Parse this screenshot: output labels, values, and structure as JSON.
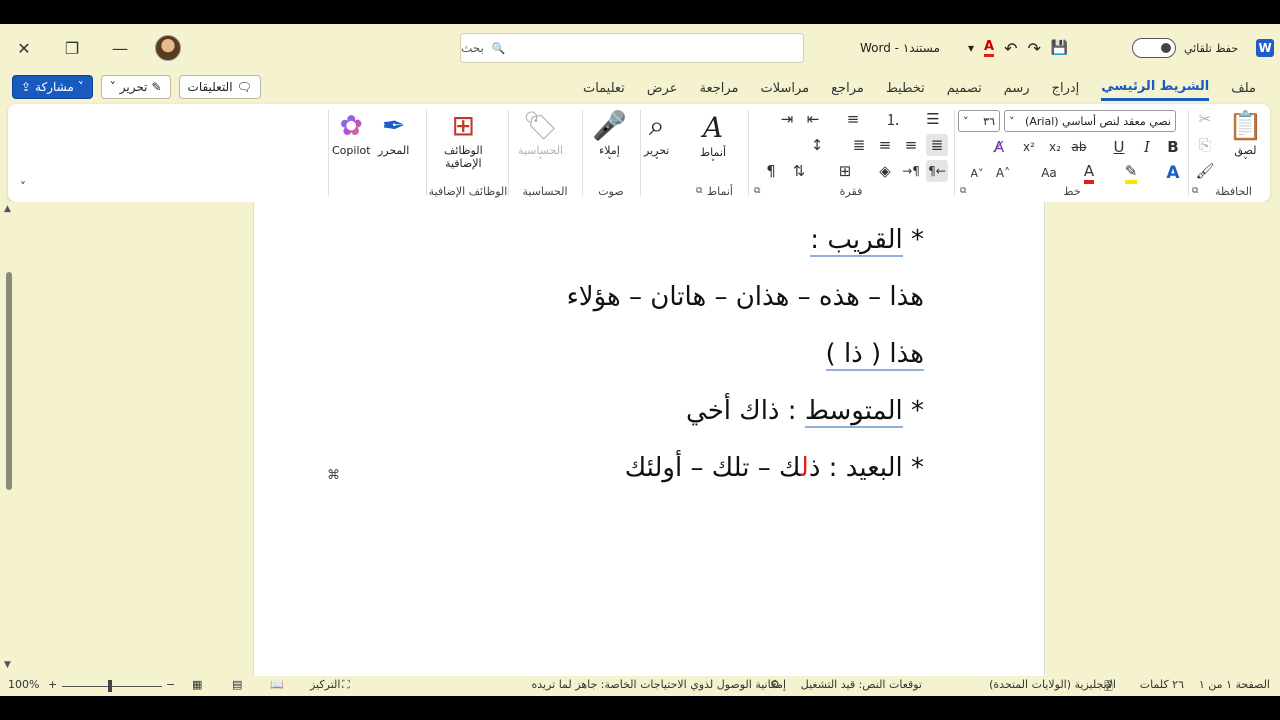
{
  "titlebar": {
    "app_logo": "W",
    "autosave_label": "حفظ تلقائي",
    "doc_title": "مستند١  -  Word",
    "search_placeholder": "بحث",
    "search_icon": "🔍",
    "close": "✕",
    "restore": "❐",
    "minimize": "—",
    "save_icon": "💾",
    "undo_icon": "↶",
    "redo_icon": "↷",
    "font_color_icon": "A",
    "customize_icon": "▾"
  },
  "tabs": {
    "items": [
      "ملف",
      "الشريط الرئيسي",
      "إدراج",
      "رسم",
      "تصميم",
      "تخطيط",
      "مراجع",
      "مراسلات",
      "مراجعة",
      "عرض",
      "تعليمات"
    ],
    "active_index": 1,
    "share_label": "مشاركة",
    "edit_label": "تحرير",
    "comments_label": "التعليقات"
  },
  "ribbon": {
    "clipboard": {
      "label": "الحافظة",
      "paste": "لصق"
    },
    "font": {
      "label": "خط",
      "font_name": "نصي معقد لنص أساسي (Arial)",
      "font_size": "٣٦",
      "bold": "B",
      "italic": "I",
      "underline": "U",
      "strike": "ab",
      "subscript": "x₂",
      "superscript": "x²",
      "grow": "A˄",
      "shrink": "A˅",
      "case": "Aa"
    },
    "paragraph": {
      "label": "فقرة"
    },
    "styles": {
      "label": "أنماط",
      "button": "أنماط"
    },
    "editing": {
      "button": "تحرير"
    },
    "voice": {
      "label": "صوت",
      "dictate": "إملاء"
    },
    "sensitivity": {
      "label": "الحساسية",
      "button": "الحساسية"
    },
    "addins": {
      "label": "الوظائف الإضافية",
      "button_line1": "الوظائف",
      "button_line2": "الإضافية"
    },
    "editor": {
      "button": "المحرر"
    },
    "copilot": {
      "button": "Copilot"
    }
  },
  "document": {
    "lines": [
      {
        "pre": "* ",
        "ul": "القريب :",
        "post": ""
      },
      {
        "pre": "هذا – هذه – هذان – هاتان – هؤلاء",
        "ul": "",
        "post": ""
      },
      {
        "pre": "",
        "ul": "هذا  ( ذا )",
        "post": ""
      },
      {
        "pre": "* ",
        "ul": "المتوسط",
        "post": " : ذاك أخي"
      }
    ],
    "line5": {
      "pre": "* البعيد : ذ",
      "red": "ل",
      "post": "ك – تلك – أولئك"
    }
  },
  "status": {
    "page": "الصفحة ١ من ١",
    "words": "٢٦ كلمات",
    "language": "الإنجليزية (الولايات المتحدة)",
    "predictions": "توقعات النص: قيد التشغيل",
    "accessibility": "إمكانية الوصول لذوي الاحتياجات الخاصة: جاهز لما تريده",
    "focus": "التركيز",
    "zoom": "100%"
  }
}
